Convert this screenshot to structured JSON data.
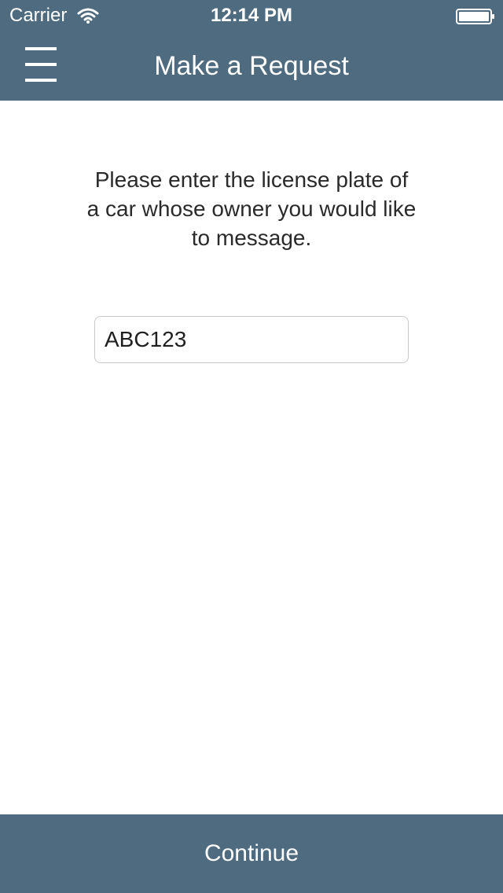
{
  "status_bar": {
    "carrier": "Carrier",
    "time": "12:14 PM",
    "wifi_icon": "wifi-icon",
    "battery_icon": "battery-icon"
  },
  "nav": {
    "title": "Make a Request",
    "menu_icon": "hamburger-menu-icon"
  },
  "main": {
    "instructions": "Please enter the license plate of a car whose owner you would like to message.",
    "plate_input_value": "ABC123"
  },
  "footer": {
    "continue_label": "Continue"
  },
  "colors": {
    "header_background": "#4f6b80",
    "button_background": "#4f6b80",
    "text_on_header": "#ffffff",
    "page_background": "#ffffff"
  }
}
